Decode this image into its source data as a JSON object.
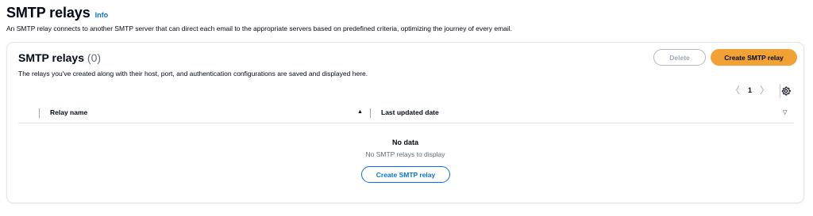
{
  "header": {
    "title": "SMTP relays",
    "info": "Info",
    "description": "An SMTP relay connects to another SMTP server that can direct each email to the appropriate servers based on predefined criteria, optimizing the journey of every email."
  },
  "container": {
    "title": "SMTP relays",
    "count": "(0)",
    "description": "The relays you've created along with their host, port, and authentication configurations are saved and displayed here.",
    "delete_label": "Delete",
    "create_label": "Create SMTP relay"
  },
  "pagination": {
    "prev": "〈",
    "page": "1",
    "next": "〉"
  },
  "table": {
    "columns": [
      {
        "label": "Relay name",
        "sort": "▲"
      },
      {
        "label": "Last updated date",
        "sort": "▽"
      }
    ]
  },
  "empty_state": {
    "title": "No data",
    "subtitle": "No SMTP relays to display",
    "button_label": "Create SMTP relay"
  },
  "colors": {
    "primary": "#f2a234",
    "link": "#0972d3",
    "disabled": "#9ba7b6",
    "border": "#e3e4e7"
  }
}
